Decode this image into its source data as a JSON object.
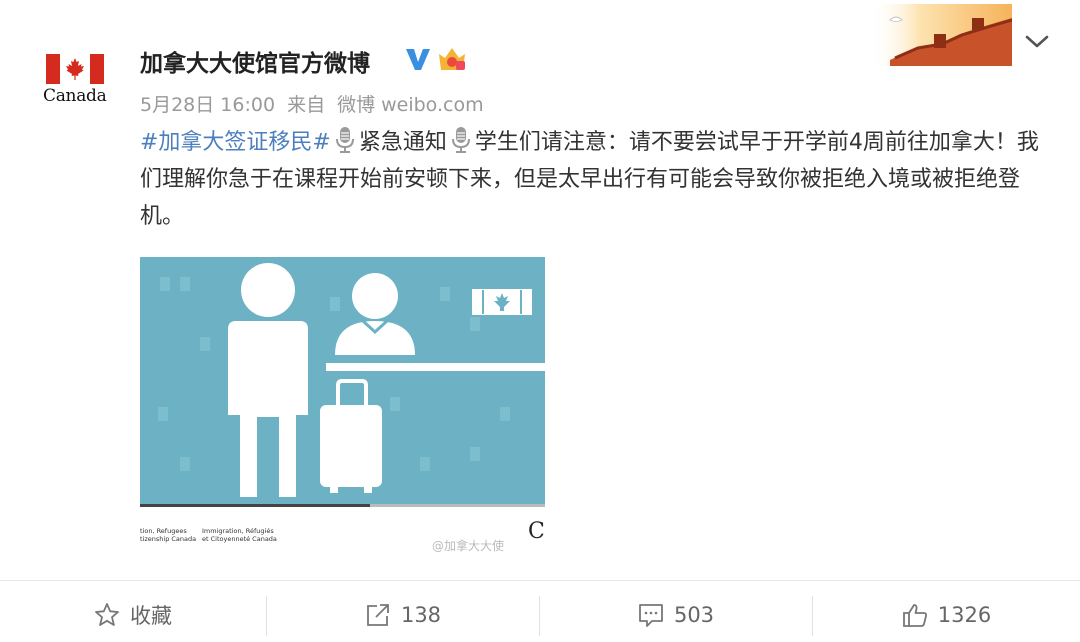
{
  "account": {
    "name": "加拿大大使馆官方微博",
    "avatar_wordmark": "Canada",
    "timestamp": "5月28日 16:00",
    "source_prefix": "来自",
    "source": "微博 weibo.com"
  },
  "post": {
    "hashtag": "#加拿大签证移民#",
    "urgent": "紧急通知",
    "body": "学生们请注意：请不要尝试早于开学前4周前往加拿大！我们理解你急于在课程开始前安顿下来，但是太早出行有可能会导致你被拒绝入境或被拒绝登机。"
  },
  "image": {
    "caption_en": "tion, Refugees tizenship Canada",
    "caption_fr": "Immigration, Réfugiés et Citoyenneté Canada",
    "watermark": "@加拿大大使",
    "corner_mark": "C"
  },
  "actions": {
    "favorite": "收藏",
    "repost": "138",
    "comment": "503",
    "like": "1326"
  },
  "colors": {
    "hashtag": "#4d7fbf",
    "canada_red": "#d52b1e",
    "image_bg": "#6cb2c4",
    "meta_grey": "#999999"
  },
  "icons": [
    "canada-flag-icon",
    "verified-icon",
    "crown-icon",
    "great-wall-icon",
    "chevron-down-icon",
    "microphone-icon",
    "star-icon",
    "repost-icon",
    "comment-icon",
    "like-icon"
  ]
}
